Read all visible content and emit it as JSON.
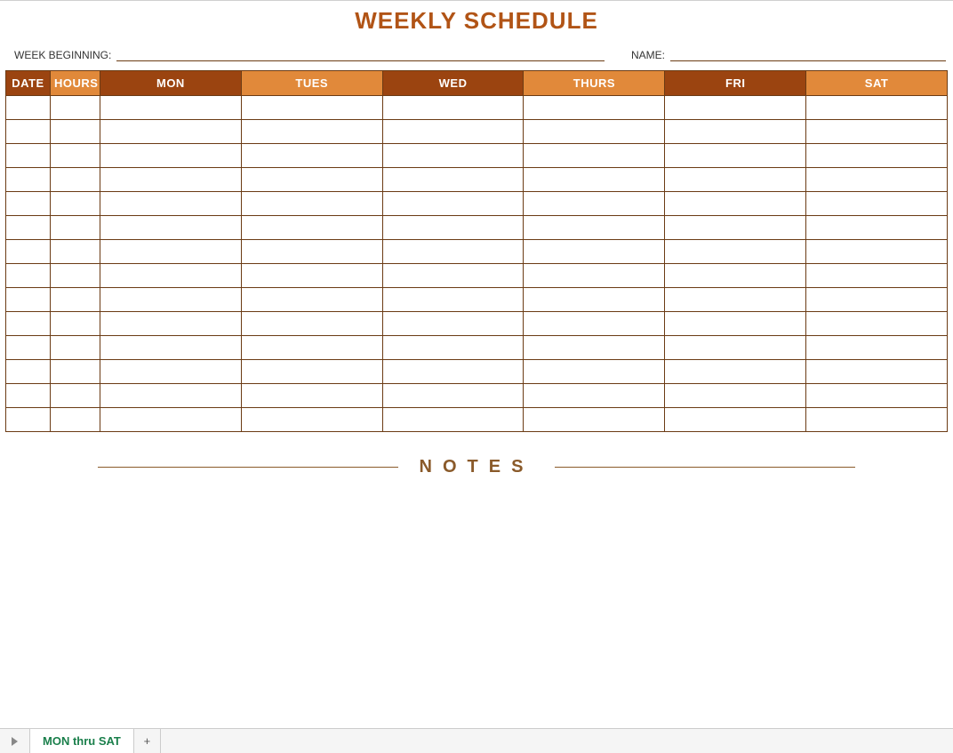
{
  "title": "WEEKLY SCHEDULE",
  "meta": {
    "week_beginning_label": "WEEK BEGINNING:",
    "week_beginning_value": "",
    "name_label": "NAME:",
    "name_value": ""
  },
  "table": {
    "headers": {
      "date": "DATE",
      "hours": "HOURS",
      "mon": "MON",
      "tues": "TUES",
      "wed": "WED",
      "thurs": "THURS",
      "fri": "FRI",
      "sat": "SAT"
    },
    "row_count": 14
  },
  "notes_label": "NOTES",
  "tabs": {
    "active": "MON thru SAT",
    "add": "+"
  }
}
